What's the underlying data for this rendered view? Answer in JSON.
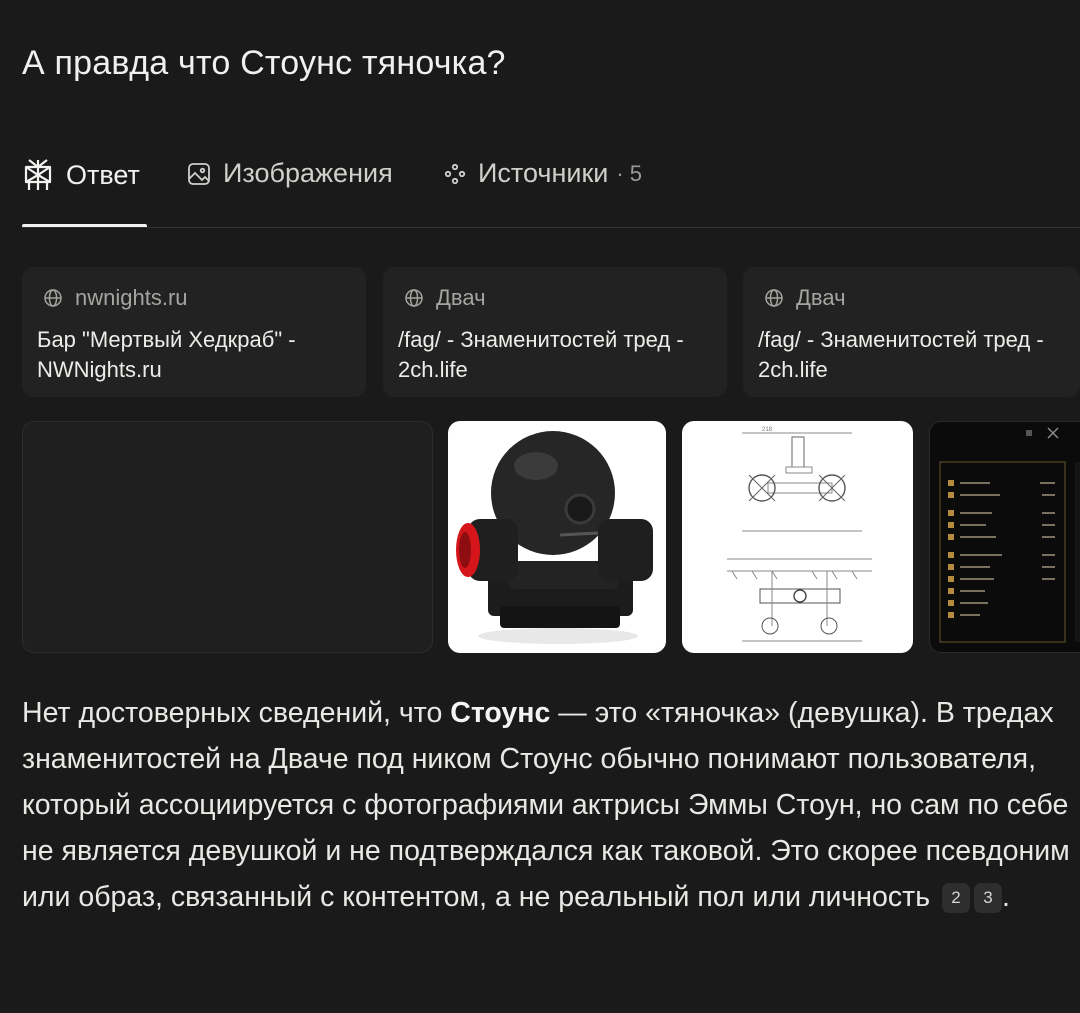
{
  "question": "А правда что Стоунс тяночка?",
  "tabs": {
    "answer": {
      "label": "Ответ",
      "icon": "perplexity-logo-icon"
    },
    "images": {
      "label": "Изображения",
      "icon": "image-icon"
    },
    "sources": {
      "label": "Источники",
      "count": "· 5",
      "icon": "sources-icon"
    }
  },
  "sources": [
    {
      "site": "nwnights.ru",
      "title": "Бар \"Мертвый Хедкраб\" - NWNights.ru",
      "icon": "globe-icon"
    },
    {
      "site": "Двач",
      "title": "/fag/ - Знаменитостей тред - 2ch.life",
      "icon": "globe-icon"
    },
    {
      "site": "Двач",
      "title": "/fag/ - Знаменитостей тред - 2ch.life",
      "icon": "globe-icon"
    }
  ],
  "images": {
    "drawing_label": "218"
  },
  "answer": {
    "part1": "Нет достоверных сведений, что ",
    "bold": "Стоунс",
    "part2": " — это «тяночка» (девушка). В тредах знаменитостей на Дваче под ником Стоунс обычно понимают пользователя, который ассоциируется с фотографиями актрисы Эммы Стоун, но сам по себе не является девушкой и не подтверждался как таковой. Это скорее псевдоним или образ, связанный с контентом, а не реальный пол или личность",
    "citations": [
      "2",
      "3"
    ],
    "end": "."
  },
  "colors": {
    "background": "#1a1a1a",
    "card": "#222222",
    "text": "#e8e8e5",
    "muted": "#a4a4a0"
  }
}
